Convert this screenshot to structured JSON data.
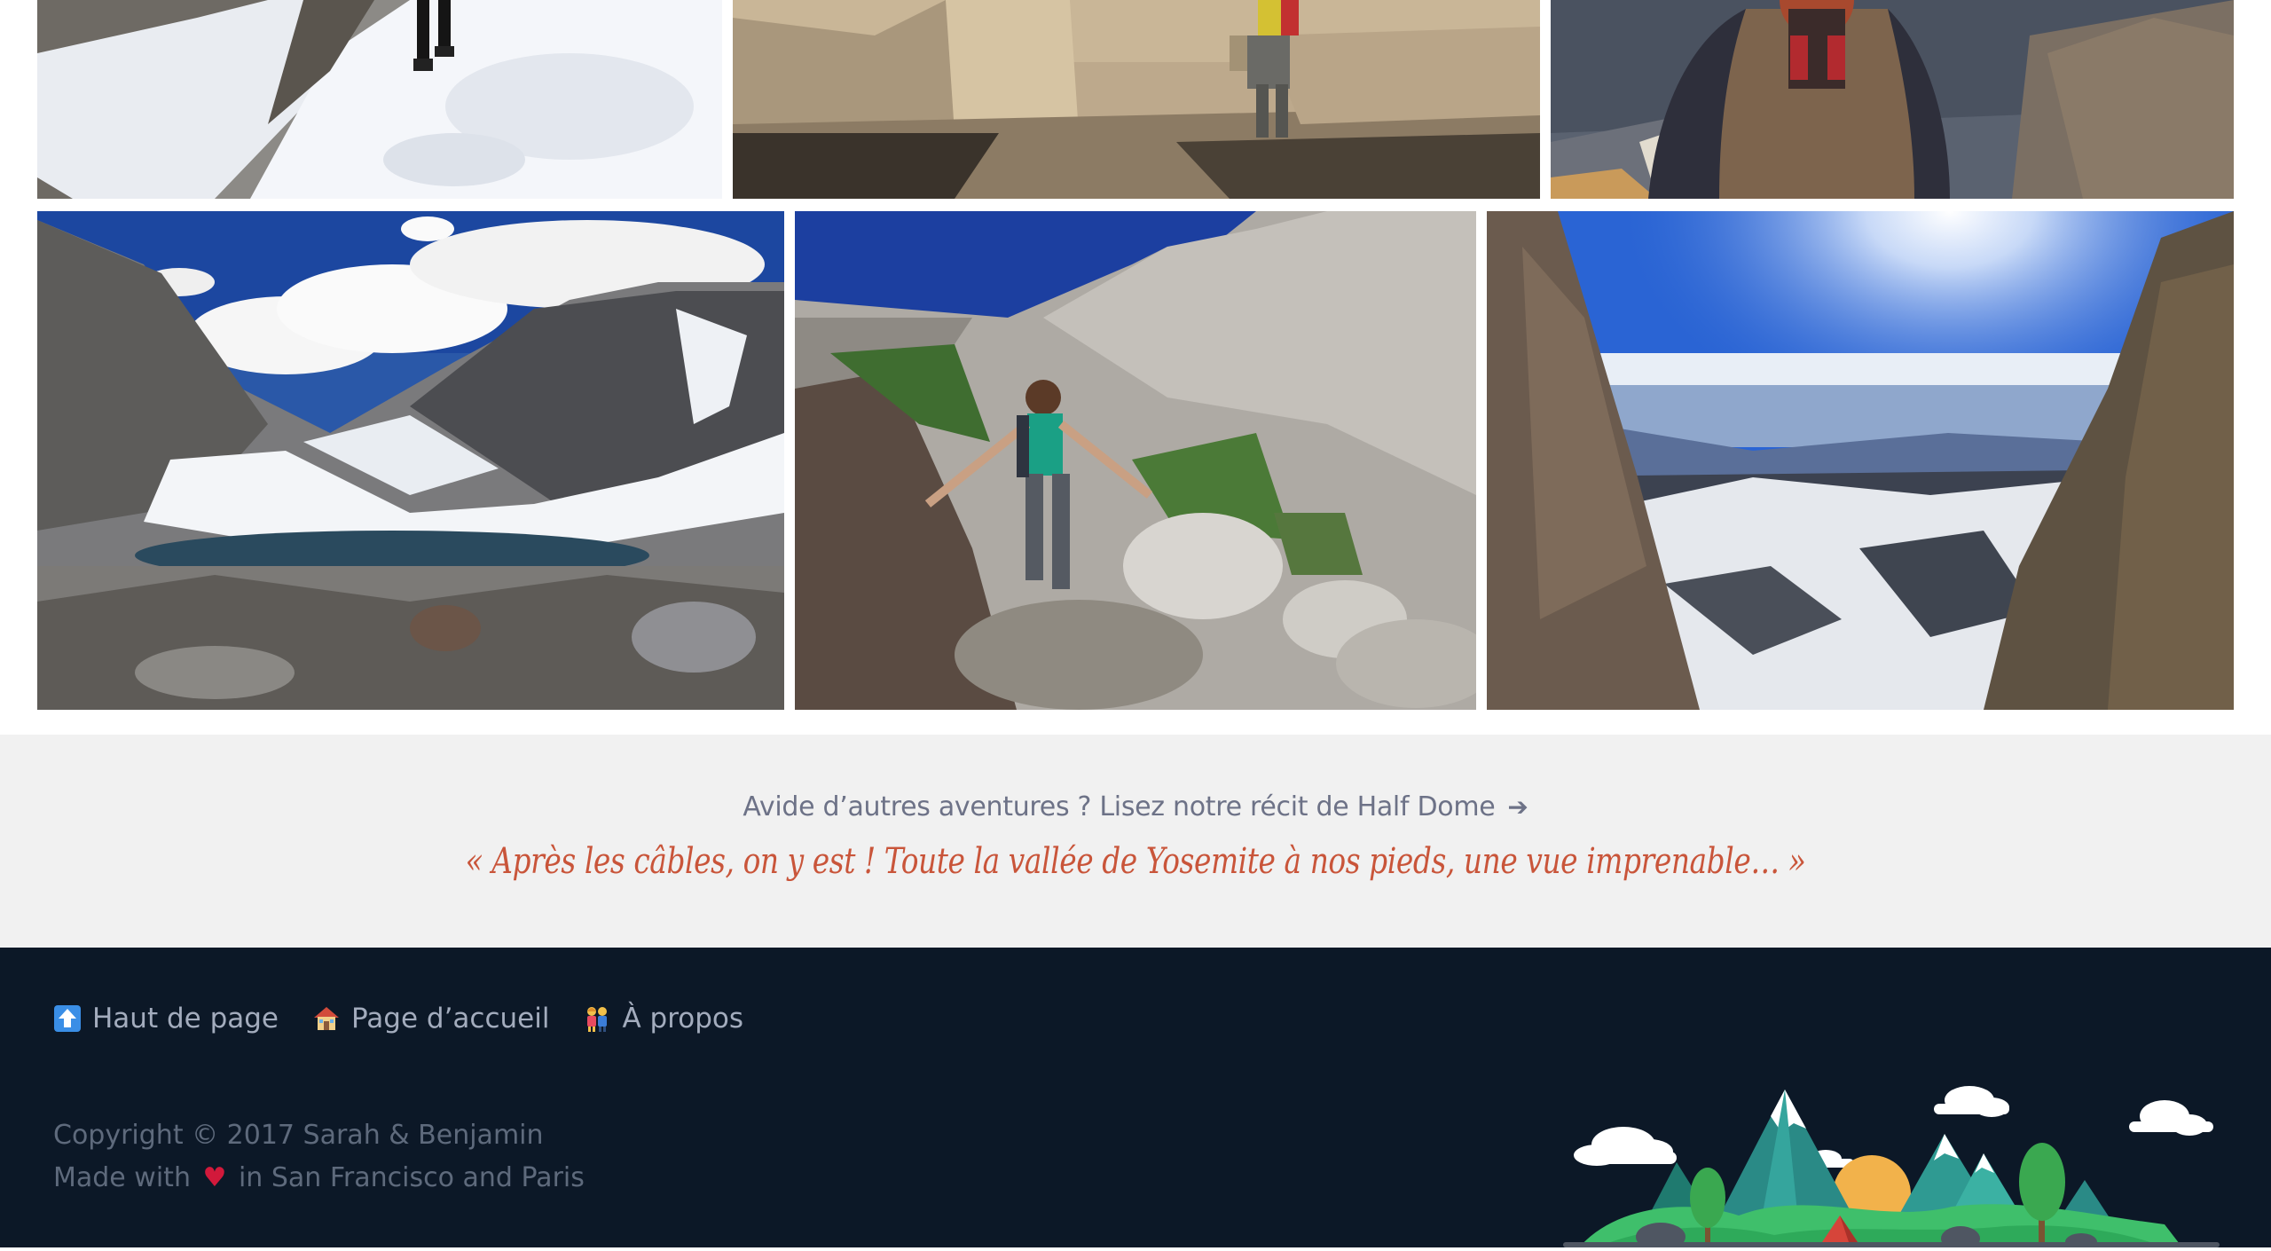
{
  "photos": [
    {
      "alt": "snowy-trail-hiker"
    },
    {
      "alt": "granite-slabs-hiker"
    },
    {
      "alt": "sleeping-bag-summit"
    },
    {
      "alt": "alpine-lake"
    },
    {
      "alt": "hiker-on-boulders"
    },
    {
      "alt": "canyon-view-sun"
    }
  ],
  "readmore": {
    "link_text": "Avide d’autres aventures ? Lisez notre récit de Half Dome",
    "arrow": "➔",
    "quote": "« Après les câbles, on y est ! Toute la vallée de Yosemite à nos pieds, une vue imprenable… »"
  },
  "footer": {
    "nav": [
      {
        "label": "Haut de page",
        "icon": "up-arrow-icon"
      },
      {
        "label": "Page d’accueil",
        "icon": "house-icon"
      },
      {
        "label": "À propos",
        "icon": "couple-icon"
      }
    ],
    "copyright": "Copyright © 2017 Sarah & Benjamin",
    "made_with_prefix": "Made with",
    "heart": "♥",
    "made_with_suffix": "in San Francisco and Paris"
  },
  "colors": {
    "footer_bg": "#0c1827",
    "band_bg": "#f1f1f1",
    "link": "#6d7287",
    "quote": "#c9553a",
    "heart": "#d2193b"
  }
}
